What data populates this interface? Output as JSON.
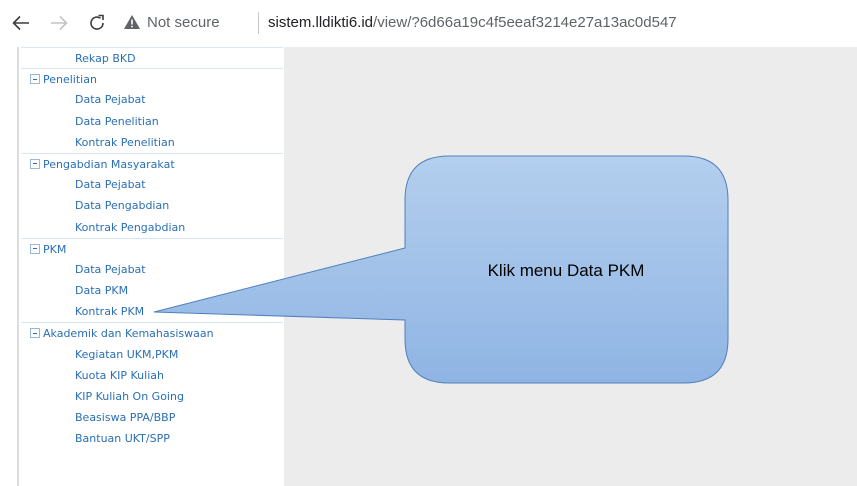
{
  "browser": {
    "security_label": "Not secure",
    "url_host": "sistem.lldikti6.id",
    "url_path": "/view/?6d66a19c4f5eeaf3214e27a13ac0d547"
  },
  "sidebar": {
    "rows": [
      {
        "type": "item",
        "label": "Rekap BKD"
      },
      {
        "type": "group",
        "label": "Penelitian"
      },
      {
        "type": "item",
        "label": "Data Pejabat"
      },
      {
        "type": "item",
        "label": "Data Penelitian"
      },
      {
        "type": "item",
        "label": "Kontrak Penelitian"
      },
      {
        "type": "group",
        "label": "Pengabdian Masyarakat"
      },
      {
        "type": "item",
        "label": "Data Pejabat"
      },
      {
        "type": "item",
        "label": "Data Pengabdian"
      },
      {
        "type": "item",
        "label": "Kontrak Pengabdian"
      },
      {
        "type": "group",
        "label": "PKM"
      },
      {
        "type": "item",
        "label": "Data Pejabat"
      },
      {
        "type": "item",
        "label": "Data PKM"
      },
      {
        "type": "item",
        "label": "Kontrak PKM"
      },
      {
        "type": "group",
        "label": "Akademik dan Kemahasiswaan"
      },
      {
        "type": "item",
        "label": "Kegiatan UKM,PKM"
      },
      {
        "type": "item",
        "label": "Kuota KIP Kuliah"
      },
      {
        "type": "item",
        "label": "KIP Kuliah On Going"
      },
      {
        "type": "item",
        "label": "Beasiswa PPA/BBP"
      },
      {
        "type": "item",
        "label": "Bantuan UKT/SPP"
      }
    ]
  },
  "callout": {
    "text": "Klik menu Data PKM",
    "fill_top": "#b4cfee",
    "fill_bottom": "#8fb4e3",
    "stroke": "#4f81bd"
  },
  "colors": {
    "link": "#2a6fb4",
    "content_bg": "#ececec"
  }
}
